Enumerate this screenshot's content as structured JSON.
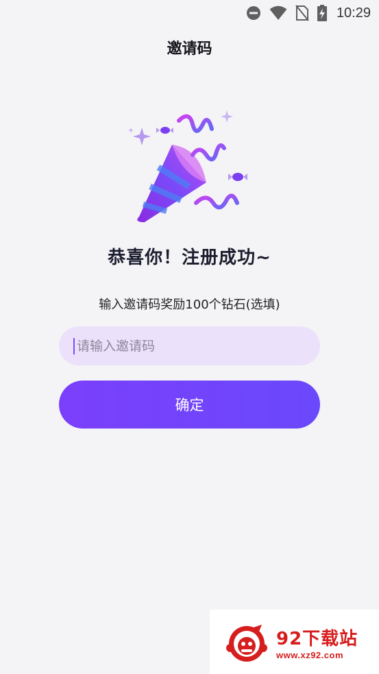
{
  "status_bar": {
    "time": "10:29",
    "icons": [
      "do-not-disturb-icon",
      "wifi-icon",
      "no-sim-icon",
      "battery-charging-icon"
    ]
  },
  "header": {
    "title": "邀请码"
  },
  "illustration": {
    "icon": "party-popper-icon",
    "colors": {
      "cone": "#7b3ffb",
      "cone_stripe": "#4f7cf5",
      "confetti": "#c63ff0",
      "sparkle": "#b59af0"
    }
  },
  "main": {
    "headline": "恭喜你！注册成功~",
    "subtext": "输入邀请码奖励100个钻石(选填)",
    "invite_input": {
      "value": "",
      "placeholder": "请输入邀请码"
    },
    "confirm_label": "确定"
  },
  "watermark": {
    "name": "92下载站",
    "url": "www.xz92.com",
    "color": "#d61e1e"
  },
  "colors": {
    "accent": "#7b3ffb",
    "input_bg": "#ece1fb",
    "background": "#f4f4f6"
  }
}
